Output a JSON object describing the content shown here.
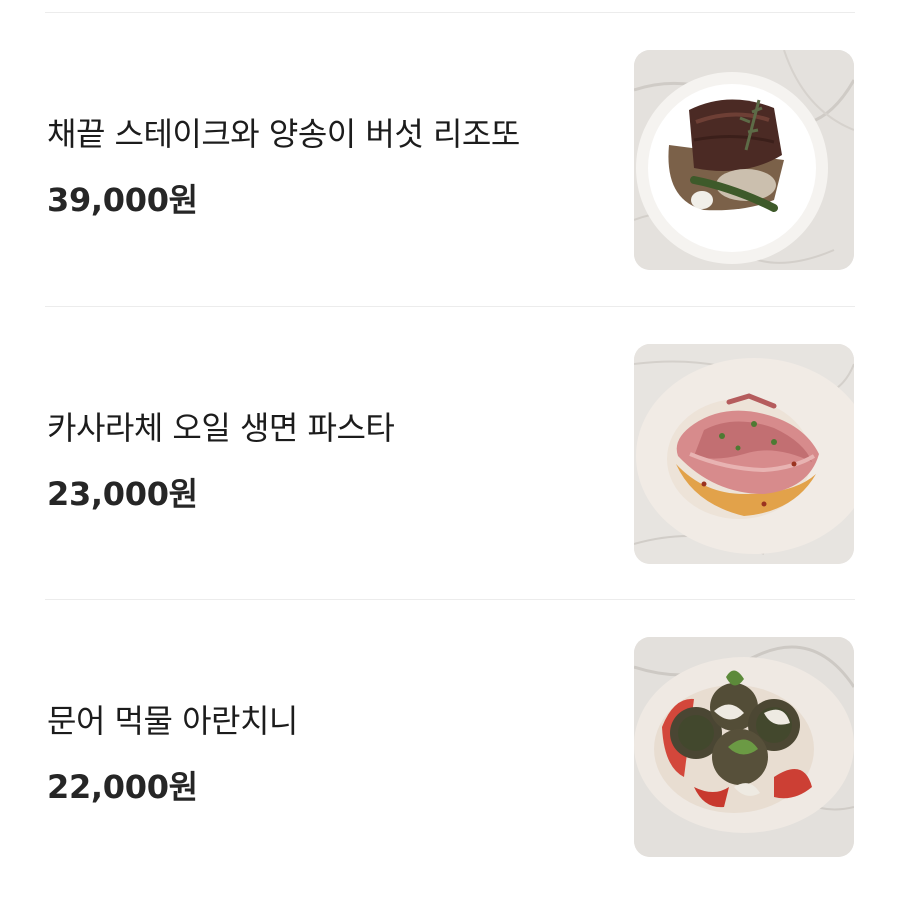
{
  "menu": {
    "items": [
      {
        "name": "채끝 스테이크와 양송이 버섯 리조또",
        "price": "39,000원",
        "image": "steak-risotto-photo"
      },
      {
        "name": "카사라체 오일 생면 파스타",
        "price": "23,000원",
        "image": "prosciutto-pasta-photo"
      },
      {
        "name": "문어 먹물 아란치니",
        "price": "22,000원",
        "image": "squid-ink-arancini-photo"
      }
    ]
  }
}
